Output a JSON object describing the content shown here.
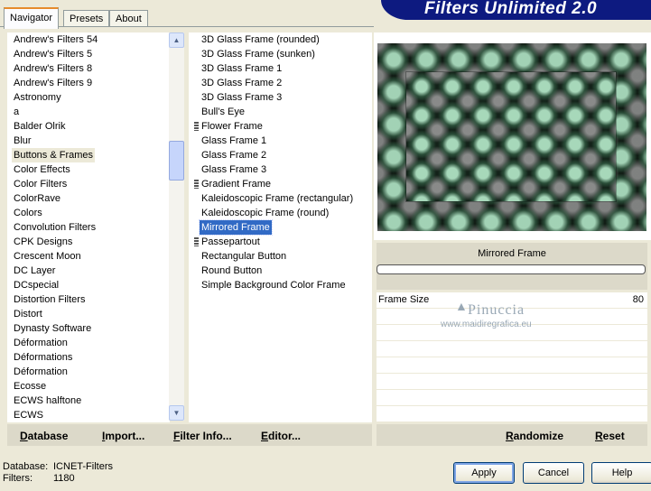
{
  "tabs": [
    "Navigator",
    "Presets",
    "About"
  ],
  "banner": "Filters Unlimited 2.0",
  "categories": [
    "Andrew's Filters 54",
    "Andrew's Filters 5",
    "Andrew's Filters 8",
    "Andrew's Filters 9",
    "Astronomy",
    "a",
    "Balder Olrik",
    "Blur",
    "Buttons & Frames",
    "Color Effects",
    "Color Filters",
    "ColorRave",
    "Colors",
    "Convolution Filters",
    "CPK Designs",
    "Crescent Moon",
    "DC Layer",
    "DCspecial",
    "Distortion Filters",
    "Distort",
    "Dynasty Software",
    "Déformation",
    "Déformations",
    "Déformation",
    "Ecosse",
    "ECWS halftone",
    "ECWS"
  ],
  "selected_category": "Buttons & Frames",
  "filters": [
    "3D Glass Frame (rounded)",
    "3D Glass Frame (sunken)",
    "3D Glass Frame 1",
    "3D Glass Frame 2",
    "3D Glass Frame 3",
    "Bull's Eye",
    "Flower Frame",
    "Glass Frame 1",
    "Glass Frame 2",
    "Glass Frame 3",
    "Gradient Frame",
    "Kaleidoscopic Frame (rectangular)",
    "Kaleidoscopic Frame (round)",
    "Mirrored Frame",
    "Passepartout",
    "Rectangular Button",
    "Round Button",
    "Simple Background Color Frame"
  ],
  "selected_filter": "Mirrored Frame",
  "preview": {
    "filter_name": "Mirrored Frame",
    "progress": 0
  },
  "params": [
    {
      "label": "Frame Size",
      "value": "80"
    }
  ],
  "watermark": {
    "name": "Pinuccia",
    "url": "www.maidiregrafica.eu"
  },
  "left_buttons": {
    "database": "Database",
    "import": "Import...",
    "filter_info": "Filter Info...",
    "editor": "Editor..."
  },
  "right_buttons": {
    "randomize": "Randomize",
    "reset": "Reset"
  },
  "status": {
    "database_label": "Database:",
    "database_value": "ICNET-Filters",
    "filters_label": "Filters:",
    "filters_value": "1180"
  },
  "dialog_buttons": {
    "apply": "Apply",
    "cancel": "Cancel",
    "help": "Help"
  },
  "colors": {
    "selection_blue": "#316ac5",
    "banner_blue": "#0d1a80",
    "dialog_bg": "#ece9d8"
  }
}
